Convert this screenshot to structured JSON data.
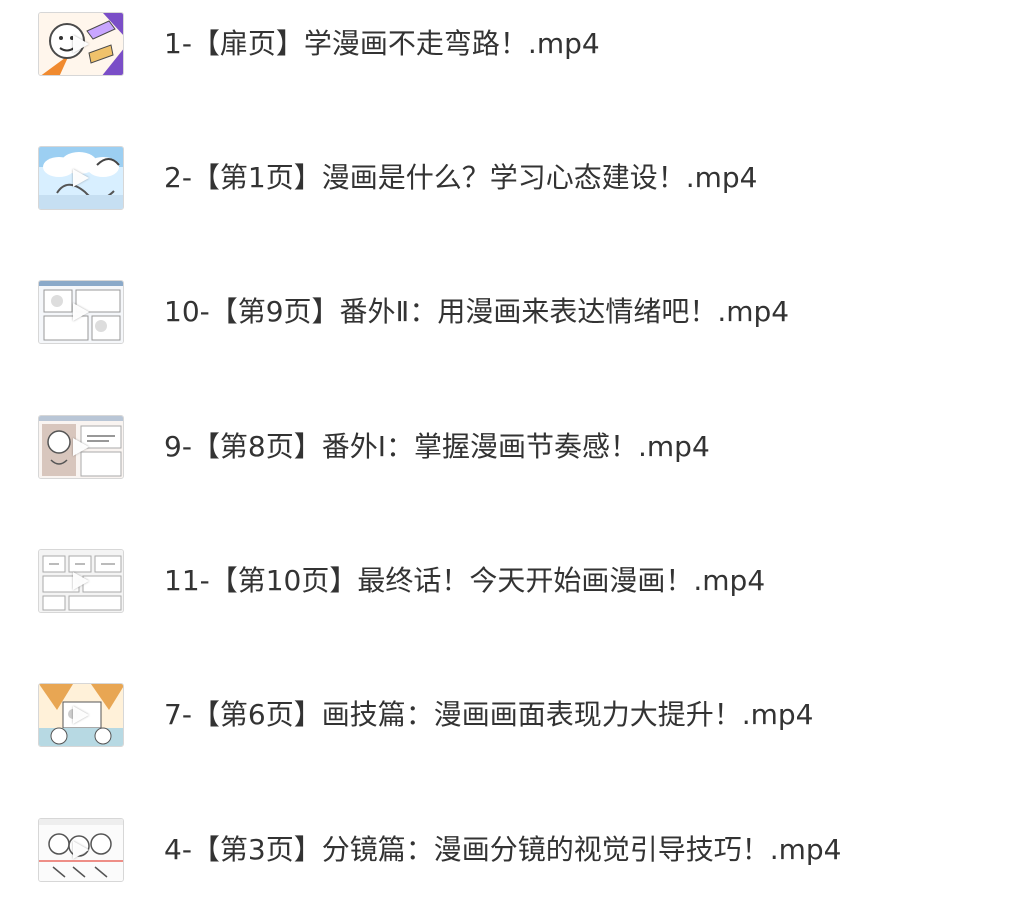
{
  "files": [
    {
      "name": "1-【扉页】学漫画不走弯路！.mp4",
      "thumb_icon": "video-thumbnail-icon",
      "accent": "#f08a2f"
    },
    {
      "name": "2-【第1页】漫画是什么？学习心态建设！.mp4",
      "thumb_icon": "video-thumbnail-icon",
      "accent": "#67b7e8"
    },
    {
      "name": "10-【第9页】番外Ⅱ：用漫画来表达情绪吧！.mp4",
      "thumb_icon": "video-thumbnail-icon",
      "accent": "#8aa9c9"
    },
    {
      "name": "9-【第8页】番外Ⅰ：掌握漫画节奏感！.mp4",
      "thumb_icon": "video-thumbnail-icon",
      "accent": "#d8c6bd"
    },
    {
      "name": "11-【第10页】最终话！今天开始画漫画！.mp4",
      "thumb_icon": "video-thumbnail-icon",
      "accent": "#9fa7b1"
    },
    {
      "name": "7-【第6页】画技篇：漫画画面表现力大提升！.mp4",
      "thumb_icon": "video-thumbnail-icon",
      "accent": "#e8a653"
    },
    {
      "name": "4-【第3页】分镜篇：漫画分镜的视觉引导技巧！.mp4",
      "thumb_icon": "video-thumbnail-icon",
      "accent": "#e96b61"
    }
  ]
}
